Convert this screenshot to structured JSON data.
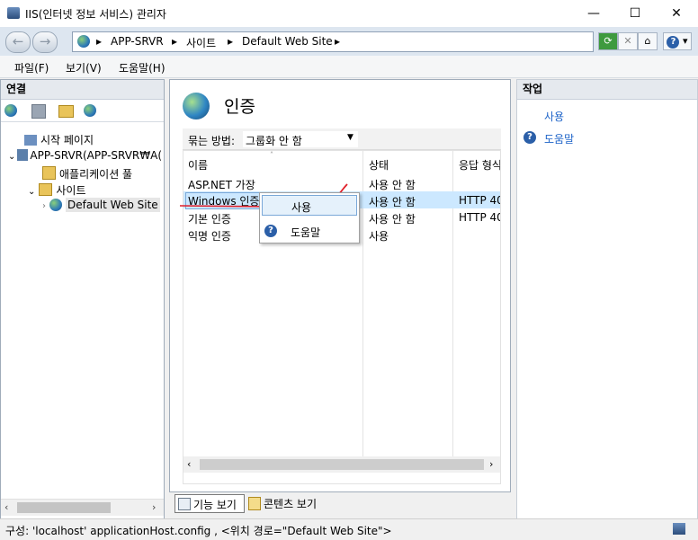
{
  "window": {
    "title": "IIS(인터넷 정보 서비스) 관리자",
    "minimize_glyph": "—",
    "maximize_glyph": "☐",
    "close_glyph": "✕"
  },
  "address": {
    "back_glyph": "←",
    "forward_glyph": "→",
    "crumbs": [
      "APP-SRVR",
      "사이트",
      "Default Web Site"
    ],
    "sep_glyph": "▸",
    "help_glyph": "?"
  },
  "menu": [
    "파일(F)",
    "보기(V)",
    "도움말(H)"
  ],
  "connections": {
    "header": "연결",
    "tree": {
      "start_page": "시작 페이지",
      "server": "APP-SRVR(APP-SRVR₩A(",
      "app_pools": "애플리케이션 풀",
      "sites": "사이트",
      "default_site": "Default Web Site"
    }
  },
  "center": {
    "title": "인증",
    "group_by_label": "묶는 방법:",
    "group_by_value": "그룹화 안 함",
    "columns": [
      "이름",
      "상태",
      "응답 형식"
    ],
    "rows": [
      {
        "name": "ASP.NET 가장",
        "status": "사용 안 함",
        "response": ""
      },
      {
        "name": "Windows 인증",
        "status": "사용 안 함",
        "response": "HTTP 40"
      },
      {
        "name": "기본 인증",
        "status": "사용 안 함",
        "response": "HTTP 40"
      },
      {
        "name": "익명 인증",
        "status": "사용",
        "response": ""
      }
    ],
    "context_menu": {
      "enable": "사용",
      "help": "도움말"
    },
    "view_tabs": {
      "features": "기능 보기",
      "content": "콘텐츠 보기"
    }
  },
  "actions": {
    "header": "작업",
    "enable_link": "사용",
    "help_link": "도움말"
  },
  "status": {
    "text": "구성: 'localhost' applicationHost.config , <위치 경로=\"Default Web Site\">"
  },
  "colors": {
    "selection": "#cce8ff",
    "annotation": "#e0202a",
    "link": "#1d63c8"
  }
}
